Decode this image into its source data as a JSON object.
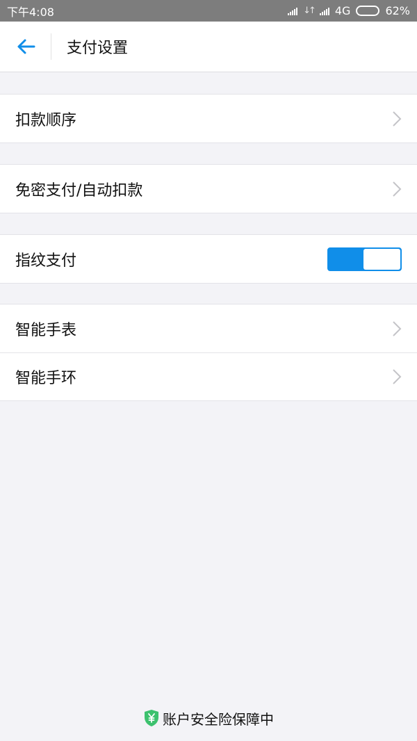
{
  "status_bar": {
    "time": "下午4:08",
    "network": "4G",
    "battery": "62%"
  },
  "nav": {
    "title": "支付设置"
  },
  "menu": {
    "deduction_order": "扣款顺序",
    "password_free": "免密支付/自动扣款",
    "fingerprint_pay": "指纹支付",
    "fingerprint_enabled": true,
    "smart_watch": "智能手表",
    "smart_band": "智能手环"
  },
  "footer": {
    "text": "账户安全险保障中"
  },
  "colors": {
    "accent": "#108ee9",
    "shield": "#3cc16e"
  }
}
